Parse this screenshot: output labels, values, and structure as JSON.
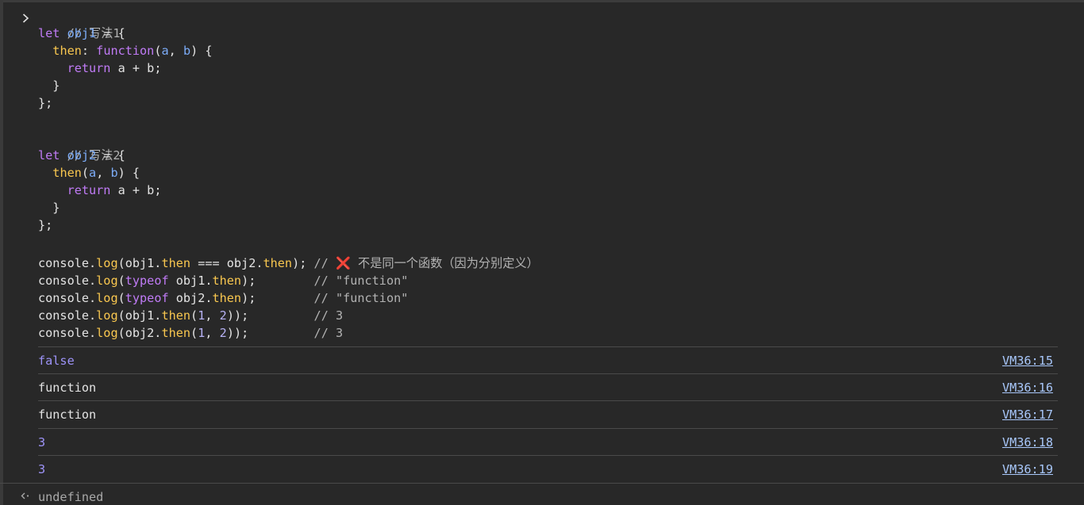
{
  "prompt_icon": "chevron-right-icon",
  "result_icon": "return-arrow-icon",
  "code": {
    "l1": {
      "comment": "// 写法1"
    },
    "l2": {
      "kw": "let",
      "var": "obj1",
      "rest": " = {"
    },
    "l3": {
      "indent": "  ",
      "prop": "then",
      "colon": ": ",
      "fn": "function",
      "open": "(",
      "p1": "a",
      "comma": ", ",
      "p2": "b",
      "close": ") {"
    },
    "l4": {
      "indent": "    ",
      "kw": "return",
      "rest": " a + b;"
    },
    "l5": {
      "text": "  }"
    },
    "l6": {
      "text": "};"
    },
    "l8": {
      "comment": "// 写法2"
    },
    "l9": {
      "kw": "let",
      "var": "obj2",
      "rest": " = {"
    },
    "l10": {
      "indent": "  ",
      "prop": "then",
      "open": "(",
      "p1": "a",
      "comma": ", ",
      "p2": "b",
      "close": ") {"
    },
    "l11": {
      "indent": "    ",
      "kw": "return",
      "rest": " a + b;"
    },
    "l12": {
      "text": "  }"
    },
    "l13": {
      "text": "};"
    },
    "l15": {
      "a": "console.",
      "log": "log",
      "b": "(obj1.",
      "then1": "then",
      "c": " === obj2.",
      "then2": "then",
      "d": "); ",
      "com1": "// ",
      "x": "❌",
      "com2": " 不是同一个函数（因为分别定义）"
    },
    "l16": {
      "a": "console.",
      "log": "log",
      "b": "(",
      "kw": "typeof",
      "c": " obj1.",
      "then": "then",
      "d": ");        ",
      "com": "// \"function\""
    },
    "l17": {
      "a": "console.",
      "log": "log",
      "b": "(",
      "kw": "typeof",
      "c": " obj2.",
      "then": "then",
      "d": ");        ",
      "com": "// \"function\""
    },
    "l18": {
      "a": "console.",
      "log": "log",
      "b": "(obj1.",
      "then": "then",
      "c": "(",
      "n1": "1",
      "comma": ", ",
      "n2": "2",
      "d": "));         ",
      "com": "// 3"
    },
    "l19": {
      "a": "console.",
      "log": "log",
      "b": "(obj2.",
      "then": "then",
      "c": "(",
      "n1": "1",
      "comma": ", ",
      "n2": "2",
      "d": "));         ",
      "com": "// 3"
    }
  },
  "logs": [
    {
      "value": "false",
      "source": "VM36:15"
    },
    {
      "value": "function",
      "source": "VM36:16"
    },
    {
      "value": "function",
      "source": "VM36:17"
    },
    {
      "value": "3",
      "source": "VM36:18"
    },
    {
      "value": "3",
      "source": "VM36:19"
    }
  ],
  "result": "undefined",
  "colors": {
    "background": "#282828",
    "keyword": "#c07bf6",
    "variable": "#7cacf8",
    "property": "#f9c74f",
    "number": "#9d93f8",
    "link": "#a8c7fa",
    "comment": "#b2b2b2"
  }
}
